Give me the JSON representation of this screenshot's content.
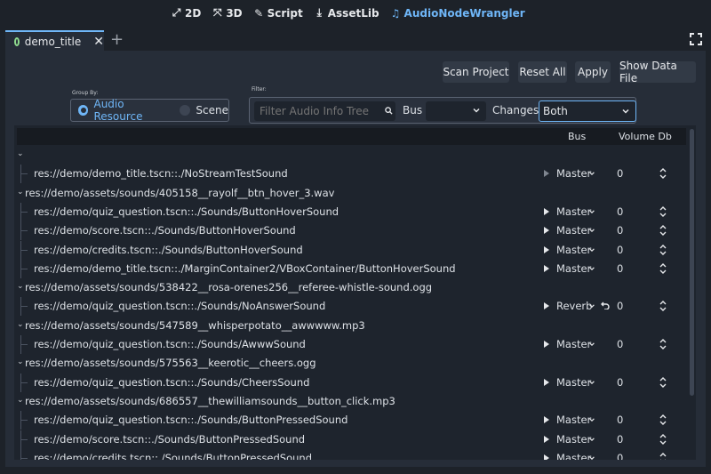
{
  "workspaces": [
    {
      "icon": "2d-icon",
      "label": "2D"
    },
    {
      "icon": "3d-icon",
      "label": "3D"
    },
    {
      "icon": "script-icon",
      "label": "Script"
    },
    {
      "icon": "assetlib-icon",
      "label": "AssetLib"
    },
    {
      "icon": "music-note-icon",
      "label": "AudioNodeWrangler",
      "active": true
    }
  ],
  "document_tab": {
    "label": "demo_title"
  },
  "toolbar": {
    "scan_project": "Scan Project",
    "reset_all": "Reset All",
    "apply": "Apply",
    "show_data_file": "Show Data File"
  },
  "group_by": {
    "label": "Group By:",
    "options": [
      "Audio Resource",
      "Scene"
    ],
    "selected": "Audio Resource"
  },
  "filter": {
    "label": "Filter:",
    "search_placeholder": "Filter Audio Info Tree",
    "bus_label": "Bus",
    "bus_value": "",
    "changes_label": "Changes",
    "changes_value": "Both"
  },
  "tree": {
    "columns": {
      "bus": "Bus",
      "volume": "Volume Db"
    },
    "rows": [
      {
        "type": "parent",
        "text": ""
      },
      {
        "type": "child",
        "text": "res://demo/demo_title.tscn::./NoStreamTestSound",
        "bus": "Master",
        "volume": "0",
        "playable": false
      },
      {
        "type": "parent",
        "text": "res://demo/assets/sounds/405158__rayolf__btn_hover_3.wav"
      },
      {
        "type": "child",
        "text": "res://demo/quiz_question.tscn::./Sounds/ButtonHoverSound",
        "bus": "Master",
        "volume": "0",
        "playable": true
      },
      {
        "type": "child",
        "text": "res://demo/score.tscn::./Sounds/ButtonHoverSound",
        "bus": "Master",
        "volume": "0",
        "playable": true
      },
      {
        "type": "child",
        "text": "res://demo/credits.tscn::./Sounds/ButtonHoverSound",
        "bus": "Master",
        "volume": "0",
        "playable": true
      },
      {
        "type": "child",
        "text": "res://demo/demo_title.tscn::./MarginContainer2/VBoxContainer/ButtonHoverSound",
        "bus": "Master",
        "volume": "0",
        "playable": true
      },
      {
        "type": "parent",
        "text": "res://demo/assets/sounds/538422__rosa-orenes256__referee-whistle-sound.ogg"
      },
      {
        "type": "child",
        "text": "res://demo/quiz_question.tscn::./Sounds/NoAnswerSound",
        "bus": "Reverb",
        "volume": "0",
        "playable": true,
        "revert": true
      },
      {
        "type": "parent",
        "text": "res://demo/assets/sounds/547589__whisperpotato__awwwww.mp3"
      },
      {
        "type": "child",
        "text": "res://demo/quiz_question.tscn::./Sounds/AwwwSound",
        "bus": "Master",
        "volume": "0",
        "playable": true
      },
      {
        "type": "parent",
        "text": "res://demo/assets/sounds/575563__keerotic__cheers.ogg"
      },
      {
        "type": "child",
        "text": "res://demo/quiz_question.tscn::./Sounds/CheersSound",
        "bus": "Master",
        "volume": "0",
        "playable": true
      },
      {
        "type": "parent",
        "text": "res://demo/assets/sounds/686557__thewilliamsounds__button_click.mp3"
      },
      {
        "type": "child",
        "text": "res://demo/quiz_question.tscn::./Sounds/ButtonPressedSound",
        "bus": "Master",
        "volume": "0",
        "playable": true
      },
      {
        "type": "child",
        "text": "res://demo/score.tscn::./Sounds/ButtonPressedSound",
        "bus": "Master",
        "volume": "0",
        "playable": true
      },
      {
        "type": "child",
        "text": "res://demo/credits.tscn::./Sounds/ButtonPressedSound",
        "bus": "Master",
        "volume": "0",
        "playable": true
      }
    ]
  },
  "colors": {
    "accent": "#6fb6f7",
    "background": "#1d2229",
    "panel": "#262d38"
  }
}
